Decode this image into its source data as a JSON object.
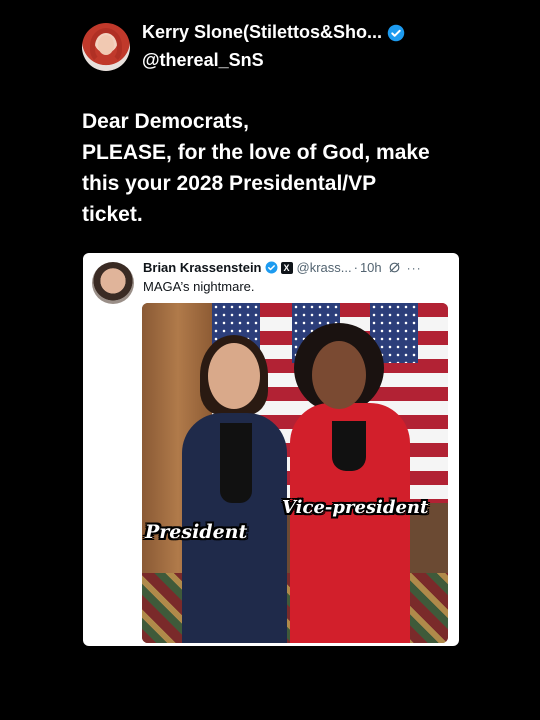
{
  "post": {
    "author_name": "Kerry Slone(Stilettos&Sho...",
    "author_handle": "@thereal_SnS",
    "text_lines": [
      "Dear Democrats,",
      "PLEASE, for the love of God, make",
      "this your 2028 Presidental/VP",
      "ticket."
    ]
  },
  "quoted": {
    "author_name": "Brian Krassenstein",
    "author_handle": "@krass...",
    "separator": "·",
    "time": "10h",
    "more": "···",
    "text": "MAGA’s nightmare.",
    "image_labels": {
      "left": "President",
      "right": "Vice-president"
    }
  },
  "colors": {
    "background": "#000000",
    "verified": "#1d9bf0",
    "card": "#ffffff"
  },
  "icons": {
    "verified": "verified-badge-icon",
    "affiliate": "x-affiliate-icon",
    "grok": "grok-icon",
    "more": "more-icon"
  }
}
